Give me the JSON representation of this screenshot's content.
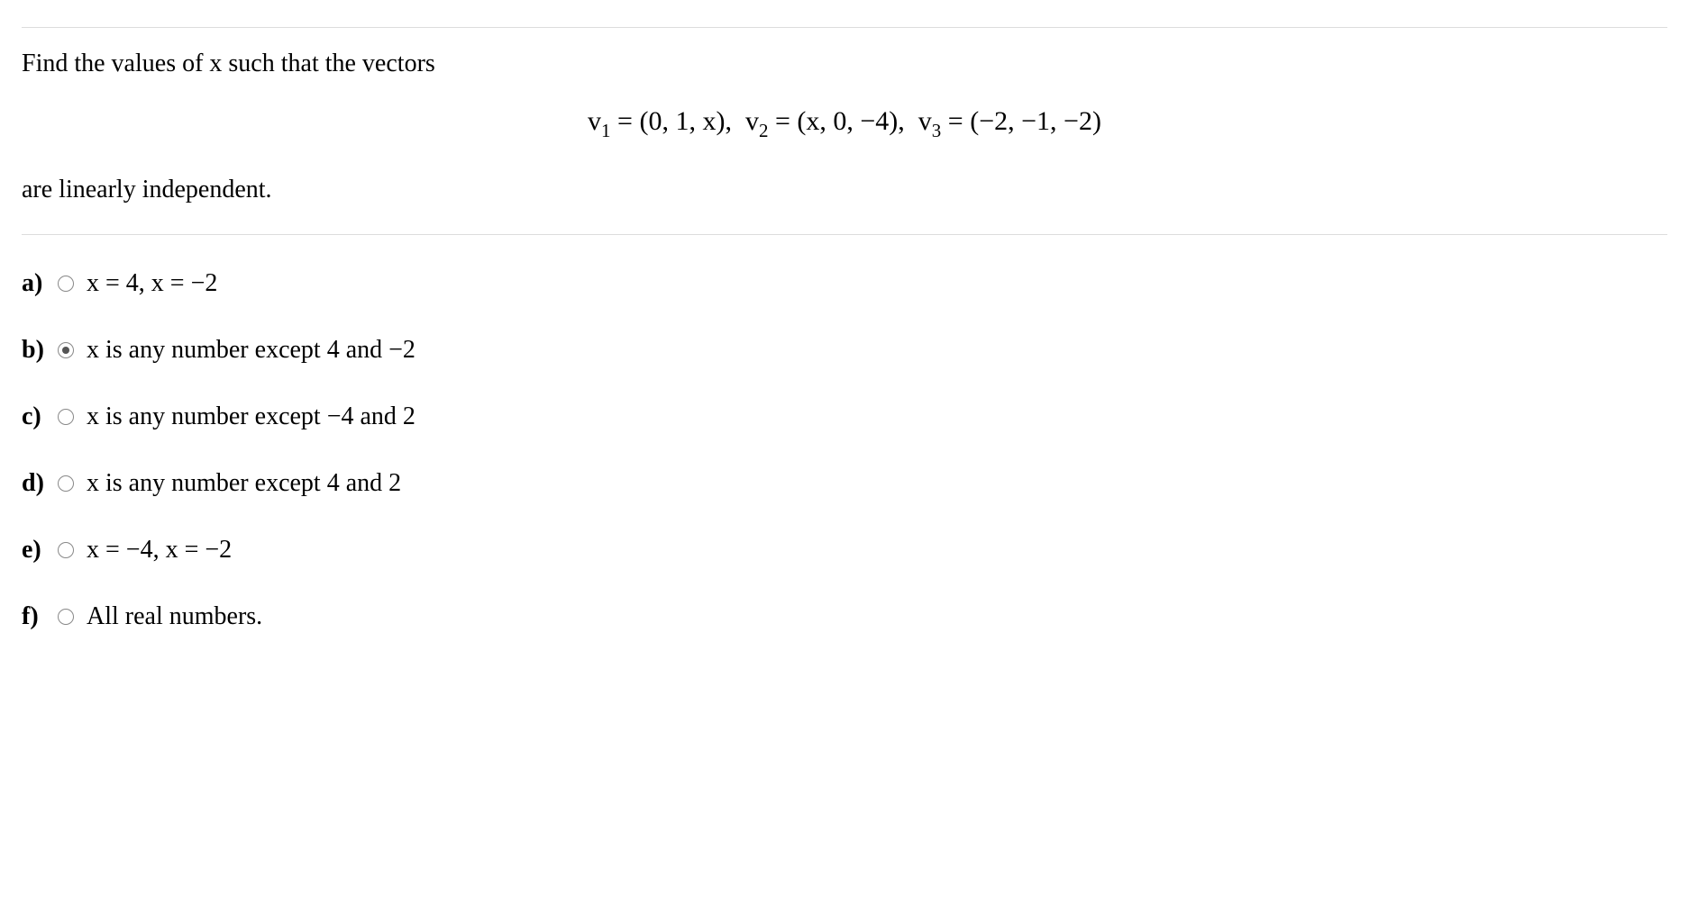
{
  "question": {
    "prompt_part1": "Find the values of  x   such that the vectors",
    "vectors_display": "v₁ = (0, 1, x),   v₂ = (x, 0, −4),   v₃ = (−2, −1, −2)",
    "prompt_part2": "are linearly independent."
  },
  "options": [
    {
      "label": "a)",
      "text": "x = 4,  x = −2",
      "selected": false
    },
    {
      "label": "b)",
      "text": "x   is any number except  4  and  −2",
      "selected": true
    },
    {
      "label": "c)",
      "text": "x   is any number except  −4   and  2",
      "selected": false
    },
    {
      "label": "d)",
      "text": "x   is any number except  4  and  2",
      "selected": false
    },
    {
      "label": "e)",
      "text": "x = −4,  x = −2",
      "selected": false
    },
    {
      "label": "f)",
      "text": "All real numbers.",
      "selected": false
    }
  ]
}
